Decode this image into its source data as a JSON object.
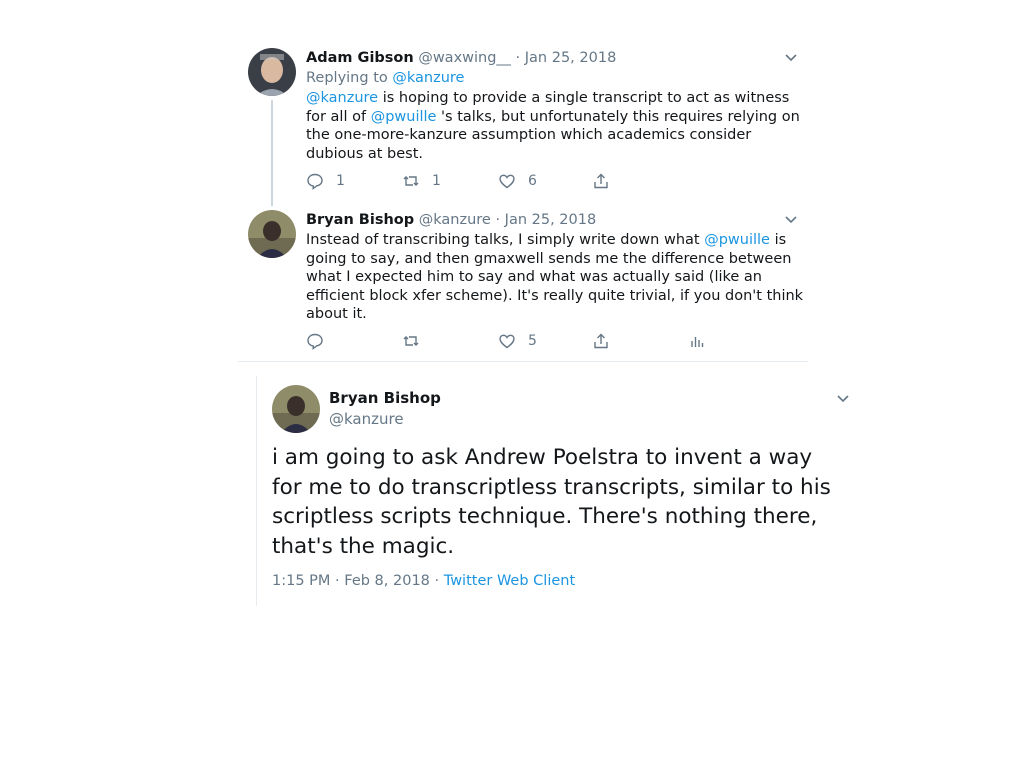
{
  "thread": [
    {
      "name": "Adam Gibson",
      "handle": "@waxwing__",
      "sep": "·",
      "date": "Jan 25, 2018",
      "replying_prefix": "Replying to ",
      "replying_to": "@kanzure",
      "text_parts": {
        "m1": "@kanzure",
        "t1": " is hoping to provide a single transcript to act as witness for all of ",
        "m2": "@pwuille",
        "t2": " 's talks, but unfortunately this requires relying on the one-more-kanzure assumption which academics consider dubious at best."
      },
      "reply_count": "1",
      "retweet_count": "1",
      "like_count": "6"
    },
    {
      "name": "Bryan Bishop",
      "handle": "@kanzure",
      "sep": "·",
      "date": "Jan 25, 2018",
      "text_parts": {
        "t1": "Instead of transcribing talks, I simply write down what ",
        "m1": "@pwuille",
        "t2": " is going to say, and then gmaxwell sends me the difference between what I expected him to say and what was actually said (like an efficient block xfer scheme). It's really quite trivial, if you don't think about it."
      },
      "like_count": "5"
    }
  ],
  "focus": {
    "name": "Bryan Bishop",
    "handle": "@kanzure",
    "text": "i am going to ask Andrew Poelstra to invent a way for me to do transcriptless transcripts, similar to his scriptless scripts technique. There's nothing there, that's the magic.",
    "time": "1:15 PM",
    "sep": "·",
    "date": "Feb 8, 2018",
    "sep2": "·",
    "client": "Twitter Web Client"
  },
  "colors": {
    "link": "#1b95e0",
    "muted": "#657786",
    "text": "#14171a",
    "line": "#ccd6dd"
  },
  "icons": [
    "chevron-down-icon",
    "reply-icon",
    "retweet-icon",
    "like-icon",
    "share-icon",
    "analytics-icon"
  ]
}
